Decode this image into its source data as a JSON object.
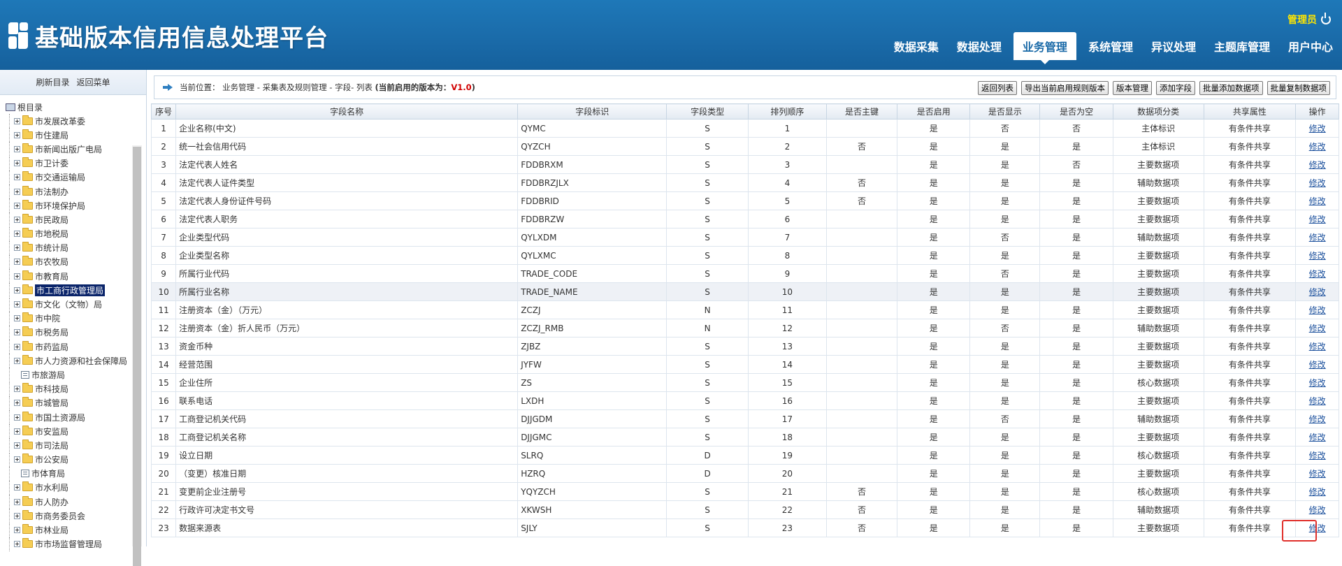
{
  "header": {
    "title": "基础版本信用信息处理平台",
    "user": "管理员",
    "nav": [
      "数据采集",
      "数据处理",
      "业务管理",
      "系统管理",
      "异议处理",
      "主题库管理",
      "用户中心"
    ],
    "active_nav": 2
  },
  "sidebar": {
    "refresh_label": "刷新目录",
    "back_label": "返回菜单",
    "root_label": "根目录",
    "nodes": [
      {
        "label": "市发展改革委",
        "type": "folder"
      },
      {
        "label": "市住建局",
        "type": "folder"
      },
      {
        "label": "市新闻出版广电局",
        "type": "folder"
      },
      {
        "label": "市卫计委",
        "type": "folder"
      },
      {
        "label": "市交通运输局",
        "type": "folder"
      },
      {
        "label": "市法制办",
        "type": "folder"
      },
      {
        "label": "市环境保护局",
        "type": "folder"
      },
      {
        "label": "市民政局",
        "type": "folder"
      },
      {
        "label": "市地税局",
        "type": "folder"
      },
      {
        "label": "市统计局",
        "type": "folder"
      },
      {
        "label": "市农牧局",
        "type": "folder"
      },
      {
        "label": "市教育局",
        "type": "folder"
      },
      {
        "label": "市工商行政管理局",
        "type": "folder",
        "selected": true
      },
      {
        "label": "市文化（文物）局",
        "type": "folder"
      },
      {
        "label": "市中院",
        "type": "folder"
      },
      {
        "label": "市税务局",
        "type": "folder"
      },
      {
        "label": "市药监局",
        "type": "folder"
      },
      {
        "label": "市人力资源和社会保障局",
        "type": "folder"
      },
      {
        "label": "市旅游局",
        "type": "doc"
      },
      {
        "label": "市科技局",
        "type": "folder"
      },
      {
        "label": "市城管局",
        "type": "folder"
      },
      {
        "label": "市国土资源局",
        "type": "folder"
      },
      {
        "label": "市安监局",
        "type": "folder"
      },
      {
        "label": "市司法局",
        "type": "folder"
      },
      {
        "label": "市公安局",
        "type": "folder"
      },
      {
        "label": "市体育局",
        "type": "doc"
      },
      {
        "label": "市水利局",
        "type": "folder"
      },
      {
        "label": "市人防办",
        "type": "folder"
      },
      {
        "label": "市商务委员会",
        "type": "folder"
      },
      {
        "label": "市林业局",
        "type": "folder"
      },
      {
        "label": "市市场监督管理局",
        "type": "folder"
      }
    ]
  },
  "breadcrumb": {
    "prefix": "当前位置：",
    "path": "业务管理 - 采集表及规则管理 - 字段- 列表",
    "version_prefix": "(当前启用的版本为：",
    "version": "V1.0",
    "version_suffix": ")"
  },
  "toolbar": [
    "返回列表",
    "导出当前启用规则版本",
    "版本管理",
    "添加字段",
    "批量添加数据项",
    "批量复制数据项"
  ],
  "table": {
    "headers": [
      "序号",
      "字段名称",
      "字段标识",
      "字段类型",
      "排列顺序",
      "是否主键",
      "是否启用",
      "是否显示",
      "是否为空",
      "数据项分类",
      "共享属性",
      "操作"
    ],
    "edit_label": "修改",
    "rows": [
      [
        "1",
        "企业名称(中文)",
        "QYMC",
        "S",
        "1",
        "",
        "是",
        "否",
        "否",
        "主体标识",
        "有条件共享"
      ],
      [
        "2",
        "统一社会信用代码",
        "QYZCH",
        "S",
        "2",
        "否",
        "是",
        "是",
        "是",
        "主体标识",
        "有条件共享"
      ],
      [
        "3",
        "法定代表人姓名",
        "FDDBRXM",
        "S",
        "3",
        "",
        "是",
        "是",
        "否",
        "主要数据项",
        "有条件共享"
      ],
      [
        "4",
        "法定代表人证件类型",
        "FDDBRZJLX",
        "S",
        "4",
        "否",
        "是",
        "是",
        "是",
        "辅助数据项",
        "有条件共享"
      ],
      [
        "5",
        "法定代表人身份证件号码",
        "FDDBRID",
        "S",
        "5",
        "否",
        "是",
        "是",
        "是",
        "主要数据项",
        "有条件共享"
      ],
      [
        "6",
        "法定代表人职务",
        "FDDBRZW",
        "S",
        "6",
        "",
        "是",
        "是",
        "是",
        "主要数据项",
        "有条件共享"
      ],
      [
        "7",
        "企业类型代码",
        "QYLXDM",
        "S",
        "7",
        "",
        "是",
        "否",
        "是",
        "辅助数据项",
        "有条件共享"
      ],
      [
        "8",
        "企业类型名称",
        "QYLXMC",
        "S",
        "8",
        "",
        "是",
        "是",
        "是",
        "主要数据项",
        "有条件共享"
      ],
      [
        "9",
        "所属行业代码",
        "TRADE_CODE",
        "S",
        "9",
        "",
        "是",
        "否",
        "是",
        "主要数据项",
        "有条件共享"
      ],
      [
        "10",
        "所属行业名称",
        "TRADE_NAME",
        "S",
        "10",
        "",
        "是",
        "是",
        "是",
        "主要数据项",
        "有条件共享"
      ],
      [
        "11",
        "注册资本（金）（万元）",
        "ZCZJ",
        "N",
        "11",
        "",
        "是",
        "是",
        "是",
        "主要数据项",
        "有条件共享"
      ],
      [
        "12",
        "注册资本（金）折人民币（万元）",
        "ZCZJ_RMB",
        "N",
        "12",
        "",
        "是",
        "否",
        "是",
        "辅助数据项",
        "有条件共享"
      ],
      [
        "13",
        "资金币种",
        "ZJBZ",
        "S",
        "13",
        "",
        "是",
        "是",
        "是",
        "主要数据项",
        "有条件共享"
      ],
      [
        "14",
        "经营范围",
        "JYFW",
        "S",
        "14",
        "",
        "是",
        "是",
        "是",
        "主要数据项",
        "有条件共享"
      ],
      [
        "15",
        "企业住所",
        "ZS",
        "S",
        "15",
        "",
        "是",
        "是",
        "是",
        "核心数据项",
        "有条件共享"
      ],
      [
        "16",
        "联系电话",
        "LXDH",
        "S",
        "16",
        "",
        "是",
        "是",
        "是",
        "主要数据项",
        "有条件共享"
      ],
      [
        "17",
        "工商登记机关代码",
        "DJJGDM",
        "S",
        "17",
        "",
        "是",
        "否",
        "是",
        "辅助数据项",
        "有条件共享"
      ],
      [
        "18",
        "工商登记机关名称",
        "DJJGMC",
        "S",
        "18",
        "",
        "是",
        "是",
        "是",
        "主要数据项",
        "有条件共享"
      ],
      [
        "19",
        "设立日期",
        "SLRQ",
        "D",
        "19",
        "",
        "是",
        "是",
        "是",
        "核心数据项",
        "有条件共享"
      ],
      [
        "20",
        "（变更）核准日期",
        "HZRQ",
        "D",
        "20",
        "",
        "是",
        "是",
        "是",
        "主要数据项",
        "有条件共享"
      ],
      [
        "21",
        "变更前企业注册号",
        "YQYZCH",
        "S",
        "21",
        "否",
        "是",
        "是",
        "是",
        "核心数据项",
        "有条件共享"
      ],
      [
        "22",
        "行政许可决定书文号",
        "XKWSH",
        "S",
        "22",
        "否",
        "是",
        "是",
        "是",
        "辅助数据项",
        "有条件共享"
      ],
      [
        "23",
        "数据来源表",
        "SJLY",
        "S",
        "23",
        "否",
        "是",
        "是",
        "是",
        "主要数据项",
        "有条件共享"
      ]
    ],
    "highlighted_row": 9
  }
}
